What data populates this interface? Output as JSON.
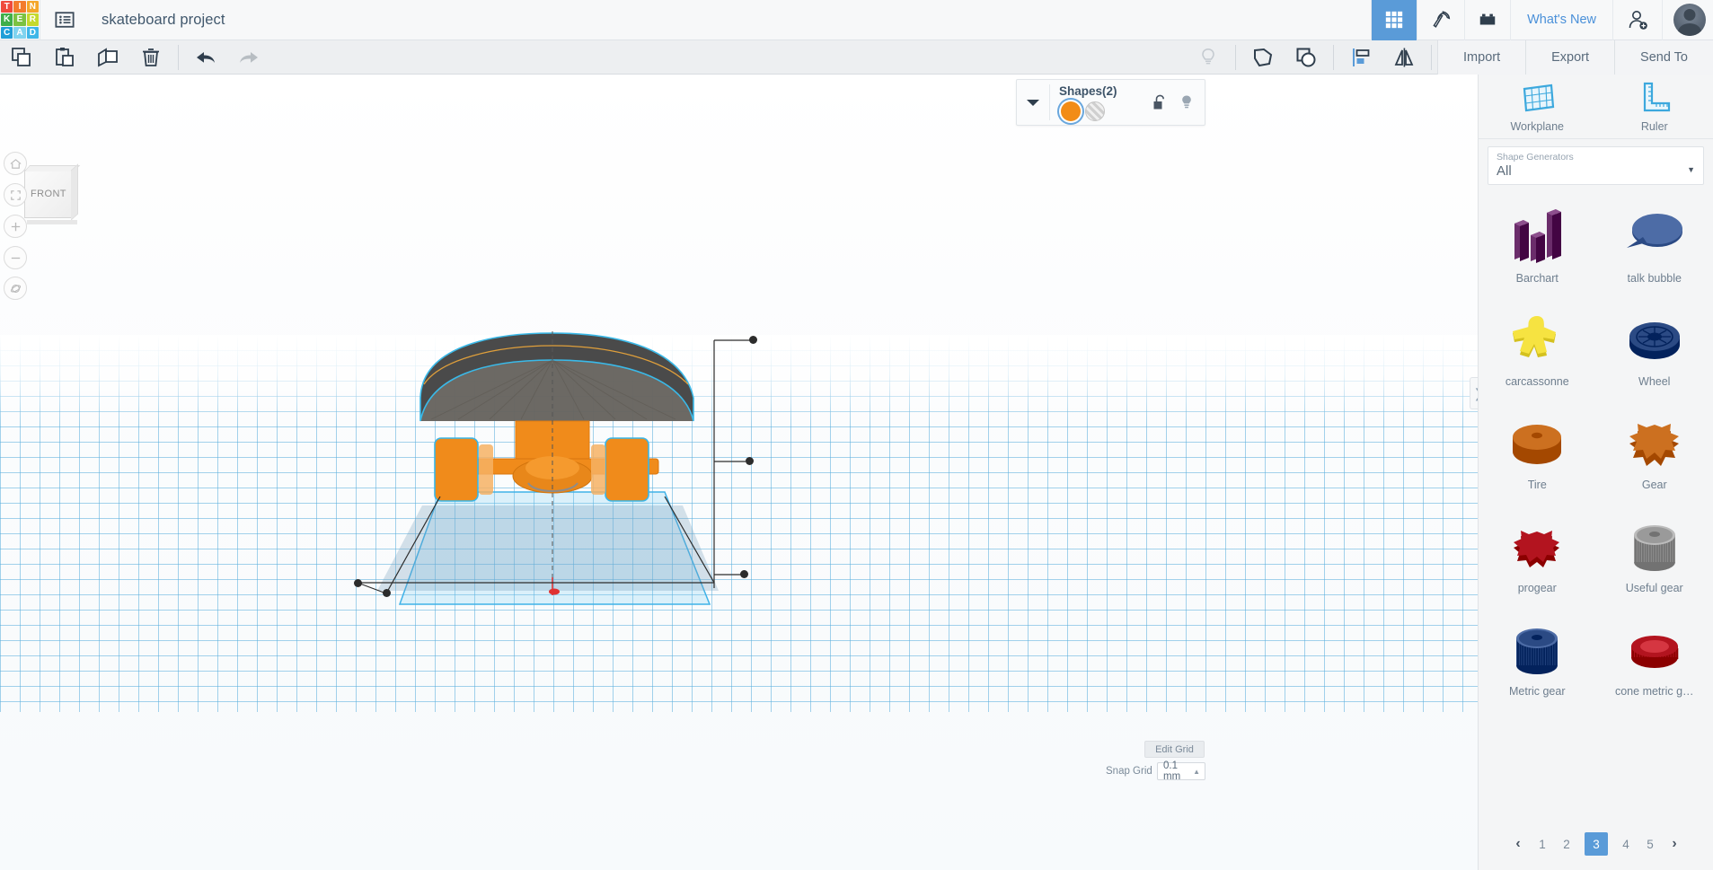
{
  "app": {
    "logo_letters": [
      {
        "ch": "T",
        "color": "#ef4a3c"
      },
      {
        "ch": "I",
        "color": "#f37b2c"
      },
      {
        "ch": "N",
        "color": "#f4a62a"
      },
      {
        "ch": "K",
        "color": "#3fae49"
      },
      {
        "ch": "E",
        "color": "#7cc242"
      },
      {
        "ch": "R",
        "color": "#c5d92d"
      },
      {
        "ch": "C",
        "color": "#1f9ed8"
      },
      {
        "ch": "A",
        "color": "#7fd3ef"
      },
      {
        "ch": "D",
        "color": "#3fb6e8"
      }
    ],
    "project_title": "skateboard project"
  },
  "topbar": {
    "icons": [
      {
        "name": "gallery-grid-icon",
        "active": true
      },
      {
        "name": "pickaxe-icon",
        "active": false
      },
      {
        "name": "lego-brick-icon",
        "active": false
      }
    ],
    "whats_new_label": "What's New",
    "invite_icon": "person-add-icon",
    "avatar": "user-avatar"
  },
  "toolbar": {
    "left_icons": [
      {
        "name": "copy-icon",
        "dim": false
      },
      {
        "name": "paste-icon",
        "dim": false
      },
      {
        "name": "duplicate-icon",
        "dim": false
      },
      {
        "name": "delete-trash-icon",
        "dim": false
      },
      {
        "name": "undo-icon",
        "dim": false
      },
      {
        "name": "redo-icon",
        "dim": true
      }
    ],
    "right_icons": [
      {
        "name": "lightbulb-icon",
        "dim": true
      },
      {
        "name": "group-shapes-icon",
        "dim": false
      },
      {
        "name": "ungroup-shapes-icon",
        "dim": false
      },
      {
        "name": "align-icon",
        "dim": false
      },
      {
        "name": "mirror-flip-icon",
        "dim": false
      }
    ],
    "import_label": "Import",
    "export_label": "Export",
    "send_to_label": "Send To"
  },
  "viewport": {
    "view_cube_label": "FRONT",
    "nav_buttons": [
      {
        "name": "home-view-icon"
      },
      {
        "name": "fit-to-view-icon"
      },
      {
        "name": "zoom-in-icon"
      },
      {
        "name": "zoom-out-icon"
      },
      {
        "name": "orbit-icon"
      }
    ],
    "edit_grid_label": "Edit Grid",
    "snap_grid_label": "Snap Grid",
    "snap_grid_value": "0.1 mm",
    "collapse_chevron": "❯"
  },
  "shapes_panel": {
    "title": "Shapes(2)",
    "caret_icon": "chevron-down-icon",
    "swatches": [
      {
        "name": "solid-color-swatch",
        "color": "#f28c17",
        "selected": true
      },
      {
        "name": "hole-swatch",
        "color": "#cfcfcf",
        "selected": false
      }
    ],
    "lock_icon": "unlock-icon",
    "light_icon": "lightbulb-icon"
  },
  "right_panel": {
    "tools": [
      {
        "name": "workplane-tool",
        "label": "Workplane",
        "icon": "workplane-grid-icon"
      },
      {
        "name": "ruler-tool",
        "label": "Ruler",
        "icon": "ruler-icon"
      }
    ],
    "selector": {
      "label": "Shape Generators",
      "value": "All",
      "caret": "▼"
    },
    "shapes": [
      {
        "label": "Barchart",
        "icon": "barchart-shape",
        "color": "#6b2d6b"
      },
      {
        "label": "talk bubble",
        "icon": "talk-bubble-shape",
        "color": "#2b4a84"
      },
      {
        "label": "carcassonne",
        "icon": "carcassonne-shape",
        "color": "#d4c11f"
      },
      {
        "label": "Wheel",
        "icon": "wheel-shape",
        "color": "#2b4a84"
      },
      {
        "label": "Tire",
        "icon": "tire-shape",
        "color": "#cc7020"
      },
      {
        "label": "Gear",
        "icon": "gear-shape",
        "color": "#cc7020"
      },
      {
        "label": "progear",
        "icon": "progear-shape",
        "color": "#b3141f"
      },
      {
        "label": "Useful gear",
        "icon": "useful-gear-shape",
        "color": "#9a9a9a"
      },
      {
        "label": "Metric gear",
        "icon": "metric-gear-shape",
        "color": "#2b4a84"
      },
      {
        "label": "cone metric g…",
        "icon": "cone-metric-gear-shape",
        "color": "#b3141f"
      }
    ],
    "pagination": {
      "prev": "‹",
      "pages": [
        "1",
        "2",
        "3",
        "4",
        "5"
      ],
      "active": "3",
      "next": "›"
    }
  },
  "colors": {
    "accent_blue": "#5a9bd8",
    "grid_blue": "#3ca0d7",
    "model_orange": "#f28c17",
    "panel_bg": "#f4f5f6"
  }
}
